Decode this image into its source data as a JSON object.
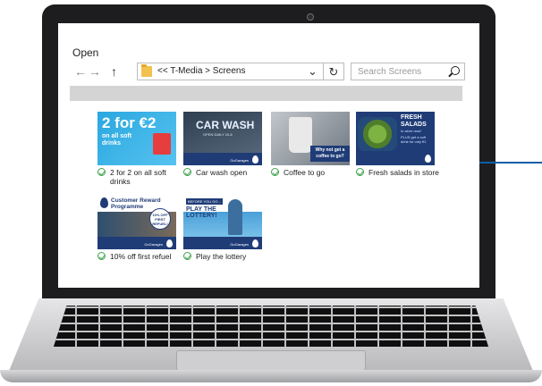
{
  "dialog": {
    "title": "Open",
    "back_icon": "arrow-left-icon",
    "forward_icon": "arrow-right-icon",
    "up_icon": "arrow-up-icon",
    "path": "<< T-Media > Screens",
    "search_placeholder": "Search Screens"
  },
  "files": [
    {
      "label": "2 for 2 on all soft drinks",
      "thumb": {
        "big": "2 for €2",
        "sub": "on all soft drinks"
      }
    },
    {
      "label": "Car wash open",
      "thumb": {
        "big": "CAR WASH",
        "sub": "OPEN DAILY 10-6"
      }
    },
    {
      "label": "Coffee to go",
      "thumb": {
        "msg": "Why not get a coffee to go?"
      }
    },
    {
      "label": "Fresh salads in store",
      "thumb": {
        "head": "FRESH SALADS",
        "sub": "In store now!",
        "small": "PLUS get a soft drink for only €1"
      }
    },
    {
      "label": "10% off first refuel",
      "thumb": {
        "head": "Customer Reward Programme",
        "badge": "10% OFF FIRST REFUEL!"
      }
    },
    {
      "label": "Play the lottery",
      "thumb": {
        "tag": "BEFORE YOU GO...",
        "head": "PLAY THE LOTTERY!"
      }
    }
  ],
  "brand": {
    "name": "GoGarages"
  },
  "colors": {
    "brand_blue": "#1f3c77",
    "accent_blue": "#0b5ea8",
    "check_green": "#3fa34d"
  }
}
